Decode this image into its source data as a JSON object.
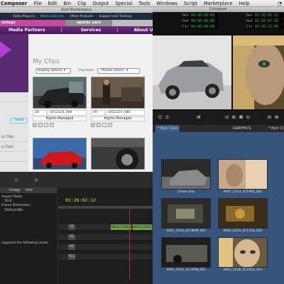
{
  "colors": {
    "accent_purple": "#5a2a73",
    "pink_tab": "#c84a9a",
    "timecode_green": "#39d04a",
    "timeline_clip_green": "#6da04a",
    "bin_blue": "#37557a"
  },
  "menubar": {
    "app": "Composer",
    "items": [
      "File",
      "Edit",
      "Bin",
      "Clip",
      "Output",
      "Special",
      "Tools",
      "Windows",
      "Script",
      "Marketplace",
      "Help"
    ],
    "icons": [
      "wifi-icon"
    ]
  },
  "marketplace": {
    "title": "Avid Marketplace",
    "nav": [
      "Video Plug-ins",
      "Media Libraries",
      "Other Products",
      "Support and Training"
    ],
    "tabs": {
      "home": "ontage",
      "current": "sports cars"
    },
    "menu": [
      "Media Partners",
      "Services",
      "About Us"
    ],
    "heading": "My Clips",
    "display_options": "Display options",
    "clip_tools_label": "Clip tools:",
    "clip_tools_placeholder": "--Please select--",
    "tweet": "Tweet",
    "left_list": [
      "",
      "ly Clips",
      "y Clips",
      ""
    ],
    "clips": [
      {
        "count": "28",
        "id": "3452224_084",
        "rights": "Rights Managed"
      },
      {
        "count": "49",
        "id": "3452224_080",
        "rights": "Rights Managed"
      }
    ]
  },
  "composer": {
    "title": "Composer",
    "left_rows": [
      {
        "label": "Dur",
        "value": "00:00:00:00"
      },
      {
        "label": "Out",
        "value": "00:00:00:00"
      },
      {
        "label": "Ctr",
        "value": "00:00:00:00"
      }
    ],
    "right_rows": [
      {
        "label": "Dur",
        "value": "01:26:02:12"
      },
      {
        "label": "Out",
        "value": "01:26:07:18"
      },
      {
        "label": "Ctr",
        "value": "01:26:11:05"
      }
    ],
    "bottom_label": "Chase Seq"
  },
  "bin": {
    "tabs": [
      "* Epic Clips",
      "GRAPHICS",
      "* Epic Cl"
    ],
    "clips": [
      "Chase Seq",
      "A007_C013_0119R5_001",
      "A001_C030_0118XM_001",
      "A001_C012_0111GS_001",
      "A001_C012_0119XN_001",
      "A001_C036_0119Q2_001"
    ]
  },
  "bottom_left": {
    "tabs": [
      "Usage",
      "Info"
    ],
    "info_lines": [
      "Aspect Ratio:",
      "16:9",
      "Frame Dimension:",
      "1920x1080",
      "",
      "supports the following raster"
    ],
    "timecode": "01:26:02:12",
    "tracks": [
      "V1",
      "A1",
      "A2",
      "TC1"
    ],
    "clip_names": [
      "HIGH_C018_0",
      "HIGH_C019_0"
    ]
  }
}
